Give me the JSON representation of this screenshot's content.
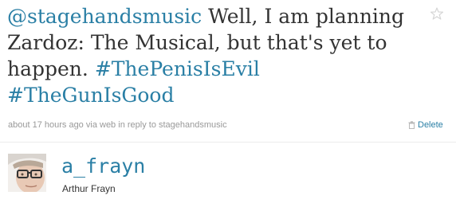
{
  "tweet": {
    "mention": "@stagehandsmusic",
    "text_part1": " Well, I am planning Zardoz: The Musical, but that's yet to happen. ",
    "hashtag1": "#ThePenisIsEvil",
    "hashtag2": "#TheGunIsGood"
  },
  "meta": {
    "timestamp": "about 17 hours ago",
    "via_prefix": " via ",
    "source": "web",
    "reply_prefix": " in reply to ",
    "reply_to": "stagehandsmusic"
  },
  "actions": {
    "delete_label": "Delete"
  },
  "author": {
    "screen_name": "a_frayn",
    "full_name": "Arthur Frayn"
  },
  "icons": {
    "favorite": "star-icon",
    "delete": "trash-icon"
  },
  "colors": {
    "link": "#2a7fa5",
    "text": "#333333",
    "meta": "#999999"
  }
}
